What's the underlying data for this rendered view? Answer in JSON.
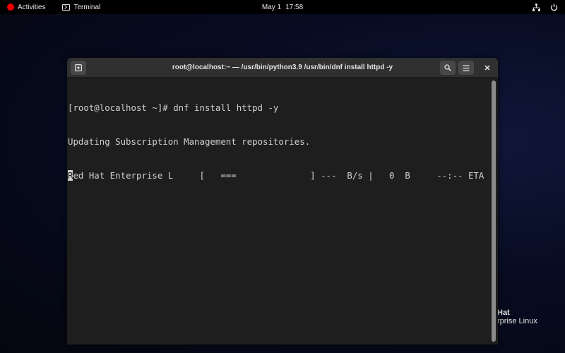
{
  "topbar": {
    "activities_label": "Activities",
    "app_label": "Terminal",
    "date": "May 1",
    "time": "17:58",
    "icons": [
      "network-icon",
      "power-icon"
    ]
  },
  "window": {
    "title": "root@localhost:~ — /usr/bin/python3.9 /usr/bin/dnf install httpd -y",
    "buttons": [
      "new-tab-icon",
      "search-icon",
      "menu-icon",
      "close-icon"
    ]
  },
  "terminal": {
    "line1": "[root@localhost ~]# dnf install httpd -y",
    "line2": "Updating Subscription Management repositories.",
    "line3_cursor_char": "R",
    "line3_rest": "ed Hat Enterprise L     [   ===              ] ---  B/s |   0  B     --:-- ETA"
  },
  "desktop": {
    "watermark_line1": "Hat",
    "watermark_line2": "rprise Linux"
  }
}
